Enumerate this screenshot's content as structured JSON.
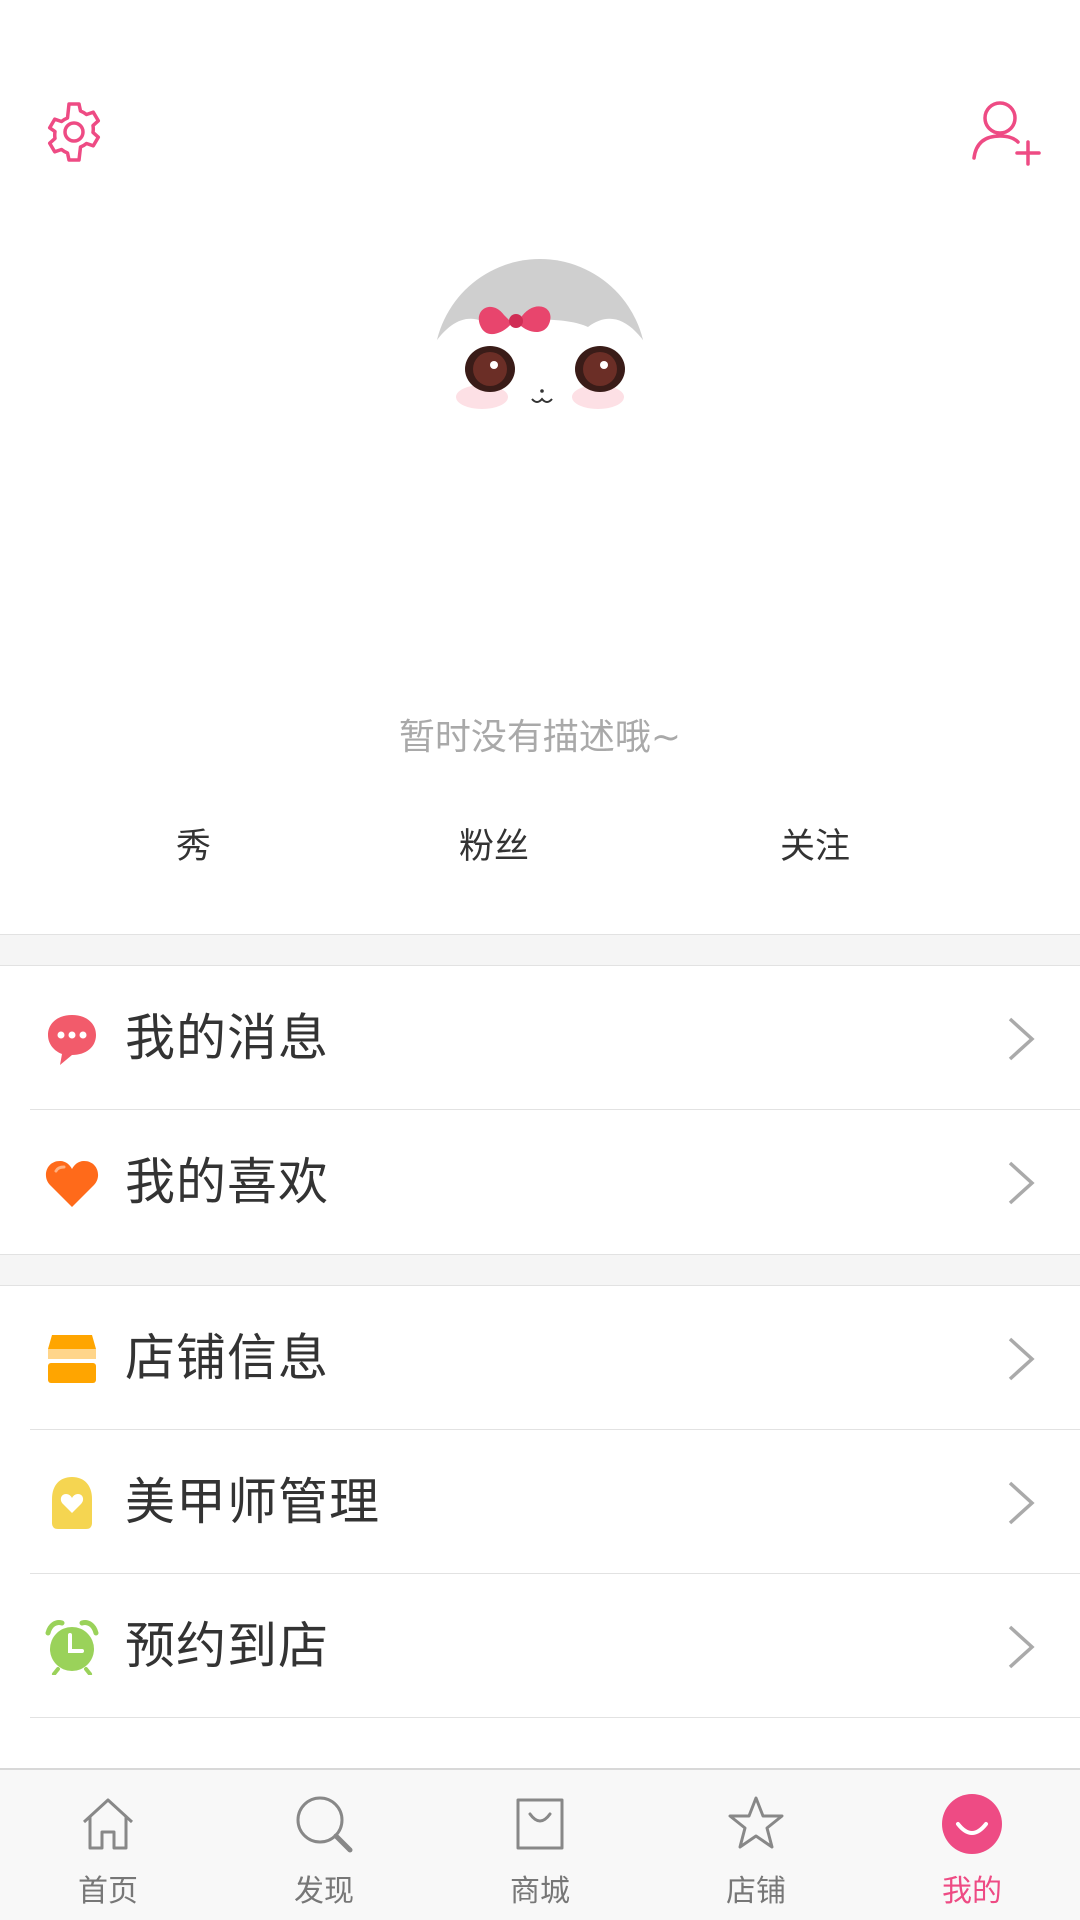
{
  "header": {
    "settings_icon": "gear-icon",
    "add_user_icon": "add-user-icon",
    "accent_color": "#ee4b84"
  },
  "profile": {
    "description": "暂时没有描述哦~",
    "stats": {
      "show": "秀",
      "fans": "粉丝",
      "follow": "关注"
    }
  },
  "menu": {
    "group1": [
      {
        "label": "我的消息",
        "icon": "message-icon",
        "color": "#f25b6b"
      },
      {
        "label": "我的喜欢",
        "icon": "heart-icon",
        "color": "#ff6a1a"
      }
    ],
    "group2": [
      {
        "label": "店铺信息",
        "icon": "shop-icon",
        "color": "#ffa500"
      },
      {
        "label": "美甲师管理",
        "icon": "nail-artist-icon",
        "color": "#f5d551"
      },
      {
        "label": "预约到店",
        "icon": "alarm-clock-icon",
        "color": "#9ad25a"
      }
    ]
  },
  "tabbar": {
    "tabs": [
      {
        "label": "首页",
        "icon": "home-icon"
      },
      {
        "label": "发现",
        "icon": "search-icon"
      },
      {
        "label": "商城",
        "icon": "shopping-bag-icon"
      },
      {
        "label": "店铺",
        "icon": "star-icon"
      },
      {
        "label": "我的",
        "icon": "smile-icon"
      }
    ],
    "active_index": 4
  }
}
